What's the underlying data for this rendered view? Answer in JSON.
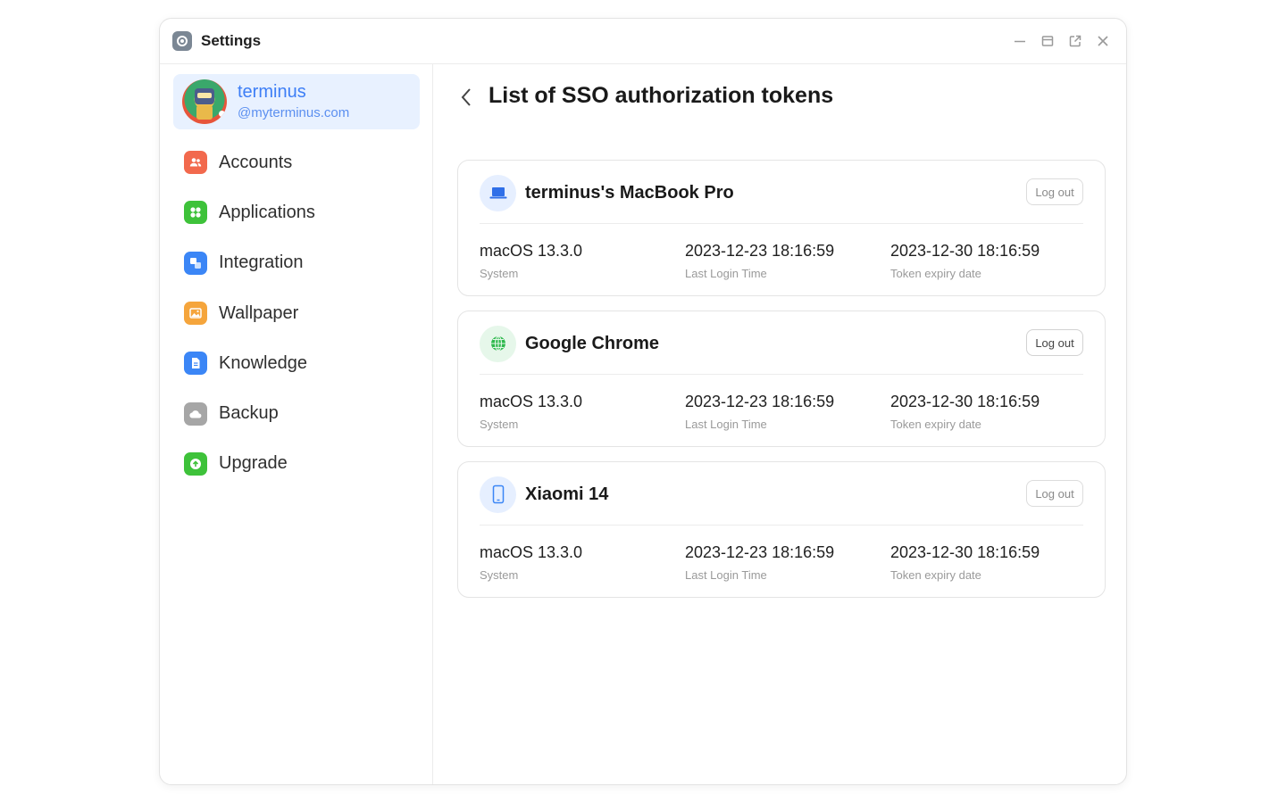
{
  "window": {
    "title": "Settings",
    "controls": [
      "minimize-icon",
      "maximize-icon",
      "popout-icon",
      "close-icon"
    ]
  },
  "profile": {
    "name": "terminus",
    "handle": "@myterminus.com"
  },
  "sidebar": {
    "items": [
      {
        "label": "Accounts",
        "icon": "accounts-icon",
        "color": "#f2694d"
      },
      {
        "label": "Applications",
        "icon": "applications-icon",
        "color": "#3ec23a"
      },
      {
        "label": "Integration",
        "icon": "integration-icon",
        "color": "#3b86f6"
      },
      {
        "label": "Wallpaper",
        "icon": "wallpaper-icon",
        "color": "#f5a53c"
      },
      {
        "label": "Knowledge",
        "icon": "knowledge-icon",
        "color": "#3b86f6"
      },
      {
        "label": "Backup",
        "icon": "backup-icon",
        "color": "#a6a6a6"
      },
      {
        "label": "Upgrade",
        "icon": "upgrade-icon",
        "color": "#3ec23a"
      }
    ]
  },
  "main": {
    "title": "List of SSO authorization tokens",
    "labels": {
      "system": "System",
      "last_login": "Last Login Time",
      "expiry": "Token expiry date"
    },
    "devices": [
      {
        "name": "terminus's MacBook Pro",
        "icon": "laptop-icon",
        "system": "macOS 13.3.0",
        "last_login": "2023-12-23 18:16:59",
        "expiry": "2023-12-30 18:16:59",
        "logout_label": "Log out"
      },
      {
        "name": "Google Chrome",
        "icon": "globe-icon",
        "system": "macOS 13.3.0",
        "last_login": "2023-12-23 18:16:59",
        "expiry": "2023-12-30 18:16:59",
        "logout_label": "Log out"
      },
      {
        "name": "Xiaomi 14",
        "icon": "phone-icon",
        "system": "macOS 13.3.0",
        "last_login": "2023-12-23 18:16:59",
        "expiry": "2023-12-30 18:16:59",
        "logout_label": "Log out"
      }
    ]
  },
  "colors": {
    "accent": "#3d7ef6",
    "profile_bg": "#e8f1ff"
  }
}
